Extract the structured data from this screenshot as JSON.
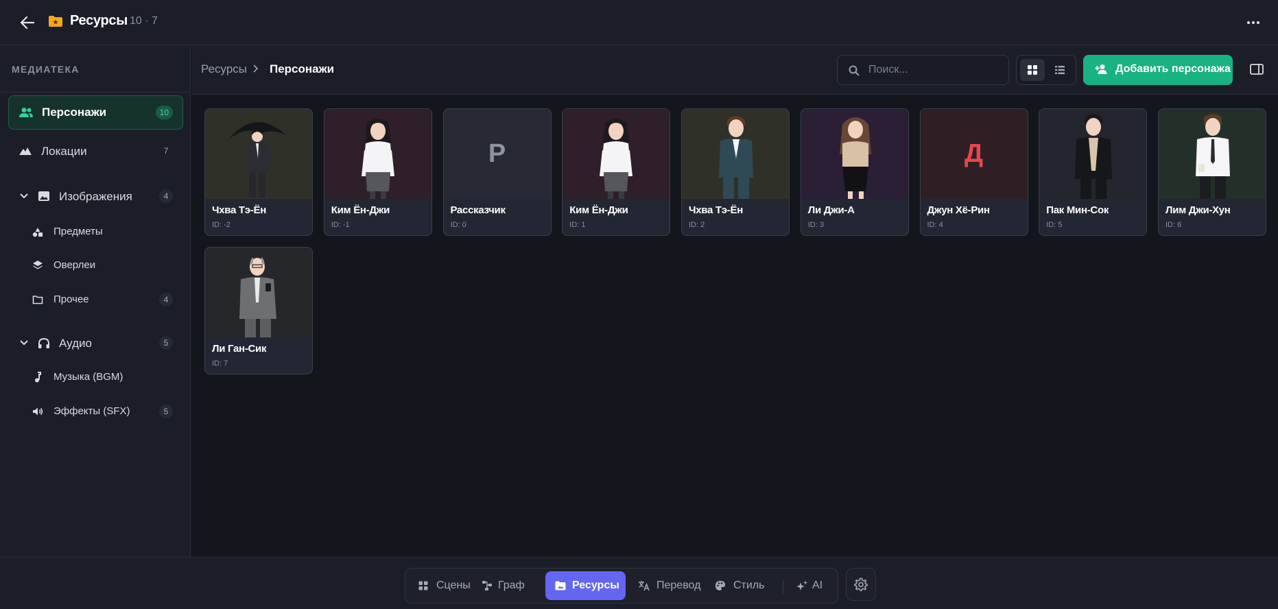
{
  "topbar": {
    "title": "Ресурсы",
    "counts": "10 · 7"
  },
  "sidebar": {
    "header": "МЕДИАТЕКА",
    "items": [
      {
        "label": "Персонажи",
        "count": "10",
        "icon": "people-icon"
      },
      {
        "label": "Локации",
        "count": "7",
        "icon": "mountains-icon"
      },
      {
        "label": "Изображения",
        "count": "4",
        "icon": "image-icon"
      },
      {
        "label": "Предметы",
        "count": "",
        "icon": "shapes-icon"
      },
      {
        "label": "Оверлеи",
        "count": "",
        "icon": "layers-icon"
      },
      {
        "label": "Прочее",
        "count": "4",
        "icon": "folder-icon"
      },
      {
        "label": "Аудио",
        "count": "5",
        "icon": "headphones-icon"
      },
      {
        "label": "Музыка (BGM)",
        "count": "",
        "icon": "music-note-icon"
      },
      {
        "label": "Эффекты (SFX)",
        "count": "5",
        "icon": "speaker-icon"
      }
    ]
  },
  "header": {
    "breadcrumb_root": "Ресурсы",
    "breadcrumb_current": "Персонажи",
    "search_placeholder": "Поиск...",
    "add_label": "Добавить персонажа"
  },
  "characters": [
    {
      "name": "Чхва Тэ-Ён",
      "id": "ID: -2",
      "bg": "#2f3128",
      "kind": "umbrella"
    },
    {
      "name": "Ким Ён-Джи",
      "id": "ID: -1",
      "bg": "#2e1f2a",
      "kind": "girl"
    },
    {
      "name": "Рассказчик",
      "id": "ID: 0",
      "bg": "#272a34",
      "letter": "Р",
      "letter_color": "#8f939e"
    },
    {
      "name": "Ким Ён-Джи",
      "id": "ID: 1",
      "bg": "#2e1f2a",
      "kind": "girl"
    },
    {
      "name": "Чхва Тэ-Ён",
      "id": "ID: 2",
      "bg": "#2f3128",
      "kind": "suit"
    },
    {
      "name": "Ли Джи-А",
      "id": "ID: 3",
      "bg": "#2a1f35",
      "kind": "woman"
    },
    {
      "name": "Джун Хё-Рин",
      "id": "ID: 4",
      "bg": "#2f1f24",
      "letter": "Д",
      "letter_color": "#e5484d"
    },
    {
      "name": "Пак Мин-Сок",
      "id": "ID: 5",
      "bg": "#23262f",
      "kind": "blackjacket"
    },
    {
      "name": "Лим Джи-Хун",
      "id": "ID: 6",
      "bg": "#23302a",
      "kind": "whiteshirt"
    },
    {
      "name": "Ли Ган-Сик",
      "id": "ID: 7",
      "bg": "#26272b",
      "kind": "oldman"
    }
  ],
  "nav": {
    "items": [
      {
        "label": "Сцены",
        "icon": "grid-icon"
      },
      {
        "label": "Граф",
        "icon": "graph-icon"
      },
      {
        "label": "Ресурсы",
        "icon": "folder-image-icon"
      },
      {
        "label": "Перевод",
        "icon": "translate-icon"
      },
      {
        "label": "Стиль",
        "icon": "palette-icon"
      },
      {
        "label": "AI",
        "icon": "sparkles-icon"
      }
    ],
    "active": "Ресурсы"
  },
  "colors": {
    "accent_green": "#19b283",
    "accent_purple": "#6366f1",
    "folder_orange": "#f5a623"
  }
}
